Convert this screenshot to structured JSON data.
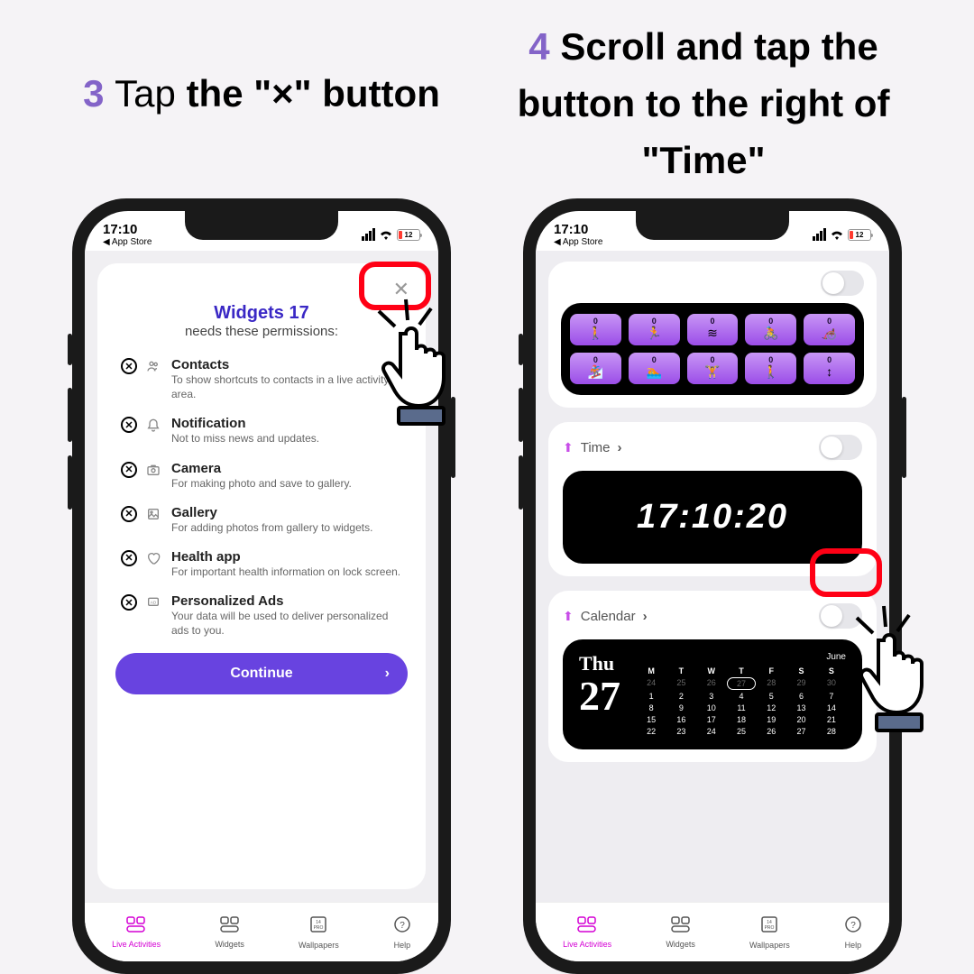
{
  "headings": {
    "step3_num": "3 ",
    "step3_text": "Tap ",
    "step3_bold": "the \"×\" button",
    "step4_num": "4 ",
    "step4_text": "Scroll and tap the button to the right of \"Time\""
  },
  "status": {
    "time": "17:10",
    "back": "◀ App Store",
    "battery": "12"
  },
  "permissions": {
    "title": "Widgets 17",
    "subtitle": "needs these permissions:",
    "continue": "Continue",
    "items": [
      {
        "name": "Contacts",
        "desc": "To show shortcuts to contacts in a live activity area."
      },
      {
        "name": "Notification",
        "desc": "Not to miss news and updates."
      },
      {
        "name": "Camera",
        "desc": "For making photo and save to gallery."
      },
      {
        "name": "Gallery",
        "desc": "For adding photos from gallery to widgets."
      },
      {
        "name": "Health app",
        "desc": "For important health information on lock screen."
      },
      {
        "name": "Personalized Ads",
        "desc": "Your data will be used to deliver personalized ads to you."
      }
    ]
  },
  "tabs": [
    {
      "label": "Live Activities"
    },
    {
      "label": "Widgets"
    },
    {
      "label": "Wallpapers"
    },
    {
      "label": "Help"
    }
  ],
  "widgets": {
    "activity_zeros": "0",
    "time_label": "Time",
    "time_value": "17:10:20",
    "calendar_label": "Calendar",
    "cal_day": "Thu",
    "cal_date": "27",
    "cal_month": "June",
    "cal_headers": [
      "M",
      "T",
      "W",
      "T",
      "F",
      "S",
      "S"
    ],
    "cal_rows": [
      [
        "24",
        "25",
        "26",
        "27",
        "28",
        "29",
        "30"
      ],
      [
        "1",
        "2",
        "3",
        "4",
        "5",
        "6",
        "7"
      ],
      [
        "8",
        "9",
        "10",
        "11",
        "12",
        "13",
        "14"
      ],
      [
        "15",
        "16",
        "17",
        "18",
        "19",
        "20",
        "21"
      ],
      [
        "22",
        "23",
        "24",
        "25",
        "26",
        "27",
        "28"
      ]
    ]
  }
}
